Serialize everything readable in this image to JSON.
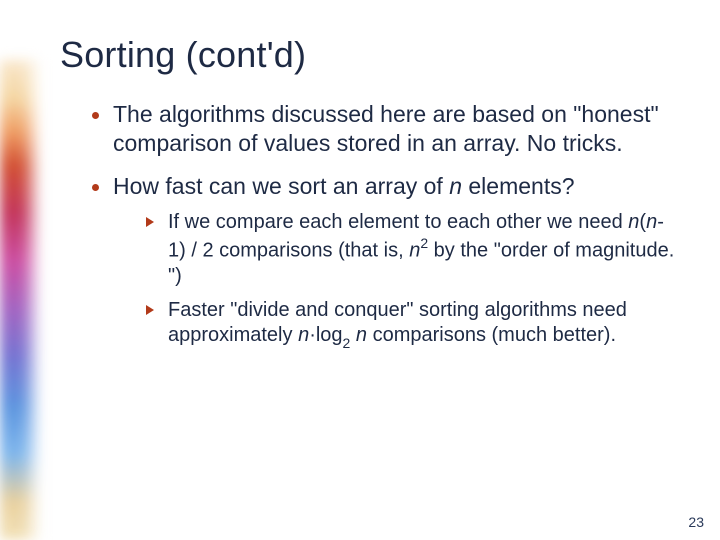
{
  "slide": {
    "title": "Sorting (cont'd)",
    "page_number": "23",
    "bullets": [
      {
        "text": "The algorithms discussed here are based on \"honest\" comparison of values stored in an array.  No tricks."
      },
      {
        "text_html": "How fast can we sort an array of <span class='ital'>n</span> elements?",
        "sub": [
          {
            "text_html": "If we compare each element to each other we need <span class='ital'>n</span>(<span class='ital'>n</span>-1) / 2 comparisons (that is, <span class='ital'>n</span><sup>2</sup> by the \"order of magnitude. \")"
          },
          {
            "text_html": "Faster \"divide and conquer\" sorting algorithms need approximately <span class='ital'>n</span>·log<sub>2</sub> <span class='ital'>n</span> comparisons (much better)."
          }
        ]
      }
    ]
  }
}
